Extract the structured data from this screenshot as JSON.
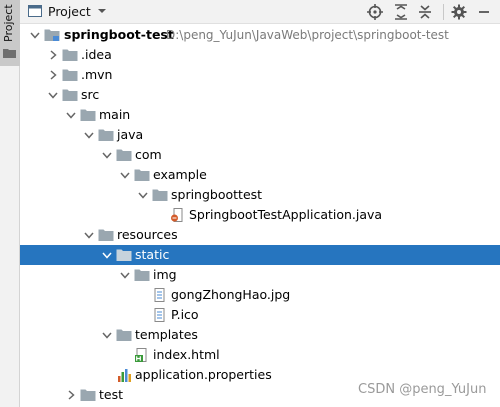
{
  "side_panel": {
    "tab_label": "Project"
  },
  "header": {
    "title": "Project"
  },
  "tree": {
    "root_name": "springboot-test",
    "root_path": "D:\\peng_YuJun\\JavaWeb\\project\\springboot-test",
    "idea": ".idea",
    "mvn": ".mvn",
    "src": "src",
    "main": "main",
    "java": "java",
    "com": "com",
    "example": "example",
    "springboottest": "springboottest",
    "app_class": "SpringbootTestApplication.java",
    "resources": "resources",
    "static": "static",
    "img": "img",
    "img_file1": "gongZhongHao.jpg",
    "img_file2": "P.ico",
    "templates": "templates",
    "index_html": "index.html",
    "app_props": "application.properties",
    "test": "test"
  },
  "watermark": "CSDN @peng_YuJun",
  "colors": {
    "selection": "#2675bf",
    "folder": "#9aa7b0",
    "module_folder": "#4a8bd6"
  }
}
